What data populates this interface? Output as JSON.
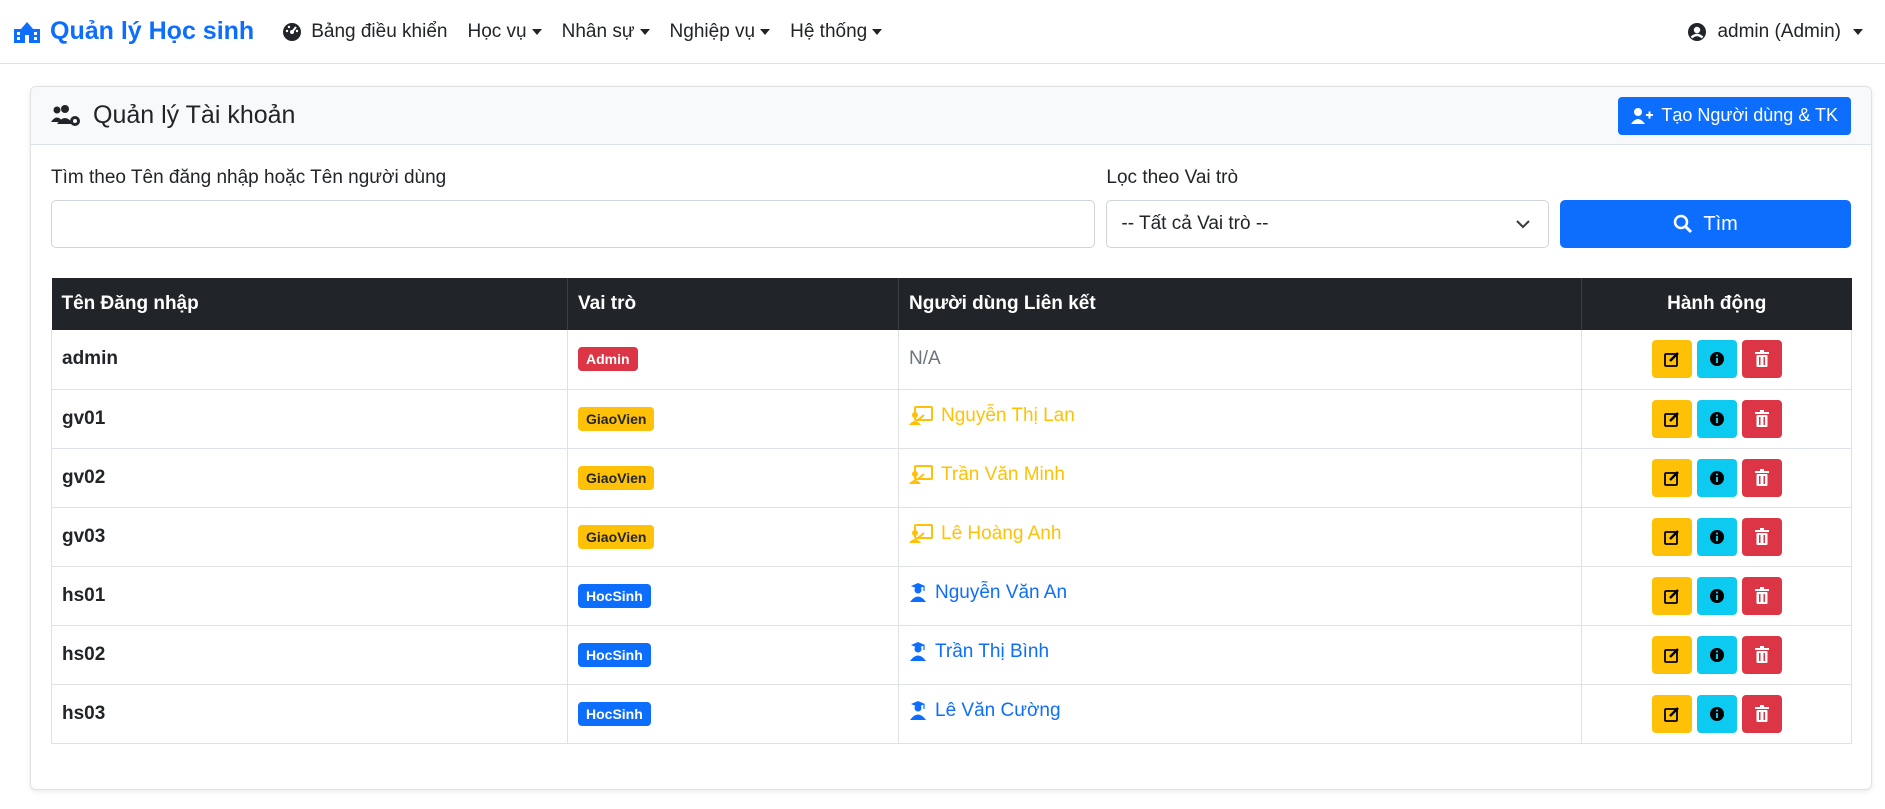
{
  "navbar": {
    "brand": "Quản lý Học sinh",
    "items": [
      {
        "label": "Bảng điều khiển",
        "icon": "dashboard-icon",
        "dropdown": false
      },
      {
        "label": "Học vụ",
        "dropdown": true
      },
      {
        "label": "Nhân sự",
        "dropdown": true
      },
      {
        "label": "Nghiệp vụ",
        "dropdown": true
      },
      {
        "label": "Hệ thống",
        "dropdown": true
      }
    ],
    "user": "admin (Admin)"
  },
  "page": {
    "title": "Quản lý Tài khoản",
    "create_button": "Tạo Người dùng & TK"
  },
  "filters": {
    "search_label": "Tìm theo Tên đăng nhập hoặc Tên người dùng",
    "search_value": "",
    "role_label": "Lọc theo Vai trò",
    "role_selected": "-- Tất cả Vai trò --",
    "search_button": "Tìm"
  },
  "table": {
    "headers": [
      "Tên Đăng nhập",
      "Vai trò",
      "Người dùng Liên kết",
      "Hành động"
    ],
    "rows": [
      {
        "username": "admin",
        "role": "Admin",
        "linked": "N/A"
      },
      {
        "username": "gv01",
        "role": "GiaoVien",
        "linked": "Nguyễn Thị Lan"
      },
      {
        "username": "gv02",
        "role": "GiaoVien",
        "linked": "Trần Văn Minh"
      },
      {
        "username": "gv03",
        "role": "GiaoVien",
        "linked": "Lê Hoàng Anh"
      },
      {
        "username": "hs01",
        "role": "HocSinh",
        "linked": "Nguyễn Văn An"
      },
      {
        "username": "hs02",
        "role": "HocSinh",
        "linked": "Trần Thị Bình"
      },
      {
        "username": "hs03",
        "role": "HocSinh",
        "linked": "Lê Văn Cường"
      }
    ]
  },
  "colors": {
    "primary": "#0d6efd",
    "admin_badge": "#dc3545",
    "teacher_badge": "#ffc107",
    "student_badge": "#0d6efd",
    "teacher_text": "#ffc107",
    "student_text": "#0d6efd",
    "header_dark": "#212529"
  }
}
